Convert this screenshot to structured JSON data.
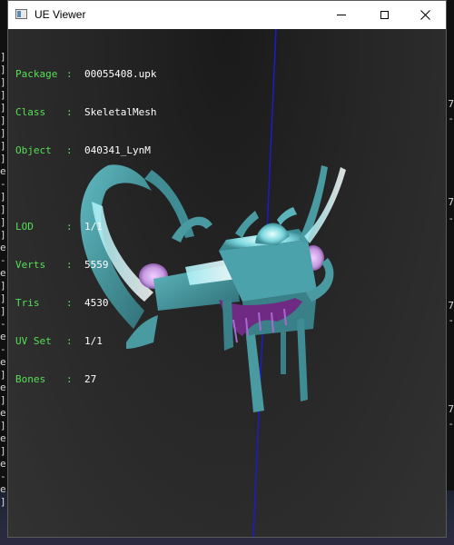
{
  "window": {
    "title": "UE Viewer"
  },
  "info": {
    "package_label": "Package",
    "package_value": "00055408.upk",
    "class_label": "Class",
    "class_value": "SkeletalMesh",
    "object_label": "Object",
    "object_value": "040341_LynM",
    "lod_label": "LOD",
    "lod_value": "1/1",
    "verts_label": "Verts",
    "verts_value": "5559",
    "tris_label": "Tris",
    "tris_value": "4530",
    "uvset_label": "UV Set",
    "uvset_value": "1/1",
    "bones_label": "Bones",
    "bones_value": "27",
    "separator": ":"
  },
  "background": {
    "left_glyphs": [
      "]",
      "]",
      "]",
      "]",
      "]",
      "]",
      "]",
      "]",
      "]",
      "e",
      "-",
      "]",
      "]",
      "]",
      "]",
      "e",
      "-",
      "e",
      "]",
      "]",
      "]",
      "-",
      "e",
      "-",
      "e",
      "]",
      "e",
      "]",
      "e",
      "]",
      "e",
      "]",
      "e",
      "-",
      "e",
      "]"
    ],
    "right_glyphs": [
      "7",
      "-",
      "7",
      "-",
      "7",
      "-",
      "7",
      "-"
    ]
  },
  "colors": {
    "mesh_teal": "#4fa6ad",
    "mesh_glow": "#bff8ff",
    "mesh_purple": "#7a2f8c",
    "axis_blue": "#1c1cc8",
    "info_green": "#55e055"
  },
  "icons": {
    "app": "window-icon",
    "minimize": "minimize-icon",
    "maximize": "maximize-icon",
    "close": "close-icon"
  }
}
